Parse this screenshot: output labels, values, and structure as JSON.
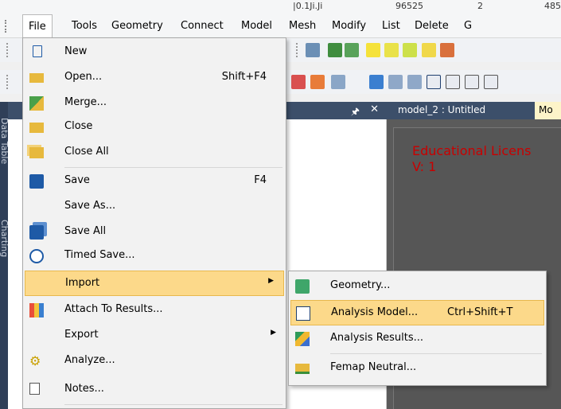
{
  "menubar": {
    "items": [
      "File",
      "Tools",
      "Geometry",
      "Connect",
      "Model",
      "Mesh",
      "Modify",
      "List",
      "Delete",
      "G"
    ]
  },
  "topstrip": {
    "values": [
      "|0.1Ji.Ji",
      "96525",
      "2",
      "485"
    ]
  },
  "left_panel": {
    "side_labels": [
      "Data Table",
      "Charting"
    ]
  },
  "tabs": {
    "model_tab": "model_2 : Untitled",
    "second_tab": "Mo"
  },
  "workspace": {
    "license_line": "Educational Licens",
    "version_line": "V: 1"
  },
  "file_menu": {
    "items": [
      {
        "label": "New",
        "shortcut": "",
        "icon": "new-file-icon"
      },
      {
        "label": "Open...",
        "shortcut": "Shift+F4",
        "icon": "open-folder-icon"
      },
      {
        "label": "Merge...",
        "shortcut": "",
        "icon": "merge-icon"
      },
      {
        "label": "Close",
        "shortcut": "",
        "icon": "close-folder-icon"
      },
      {
        "label": "Close All",
        "shortcut": "",
        "icon": "close-all-icon"
      },
      {
        "label": "Save",
        "shortcut": "F4",
        "icon": "save-icon"
      },
      {
        "label": "Save As...",
        "shortcut": "",
        "icon": ""
      },
      {
        "label": "Save All",
        "shortcut": "",
        "icon": "save-all-icon"
      },
      {
        "label": "Timed Save...",
        "shortcut": "",
        "icon": "timed-save-icon"
      },
      {
        "label": "Import",
        "shortcut": "",
        "icon": "",
        "submenu": true
      },
      {
        "label": "Attach To Results...",
        "shortcut": "",
        "icon": "attach-results-icon"
      },
      {
        "label": "Export",
        "shortcut": "",
        "icon": "",
        "submenu": true
      },
      {
        "label": "Analyze...",
        "shortcut": "",
        "icon": "analyze-icon"
      },
      {
        "label": "Notes...",
        "shortcut": "",
        "icon": "notes-icon"
      }
    ]
  },
  "import_submenu": {
    "items": [
      {
        "label": "Geometry...",
        "shortcut": "",
        "icon": "import-geometry-icon"
      },
      {
        "label": "Analysis Model...",
        "shortcut": "Ctrl+Shift+T",
        "icon": "import-analysis-model-icon"
      },
      {
        "label": "Analysis Results...",
        "shortcut": "",
        "icon": "import-analysis-results-icon"
      },
      {
        "label": "Femap Neutral...",
        "shortcut": "",
        "icon": "femap-neutral-icon"
      }
    ]
  },
  "colors": {
    "highlight": "#fcd98a",
    "panel_header": "#3c4f6a",
    "workspace": "#565656",
    "license_text": "#c90000"
  }
}
